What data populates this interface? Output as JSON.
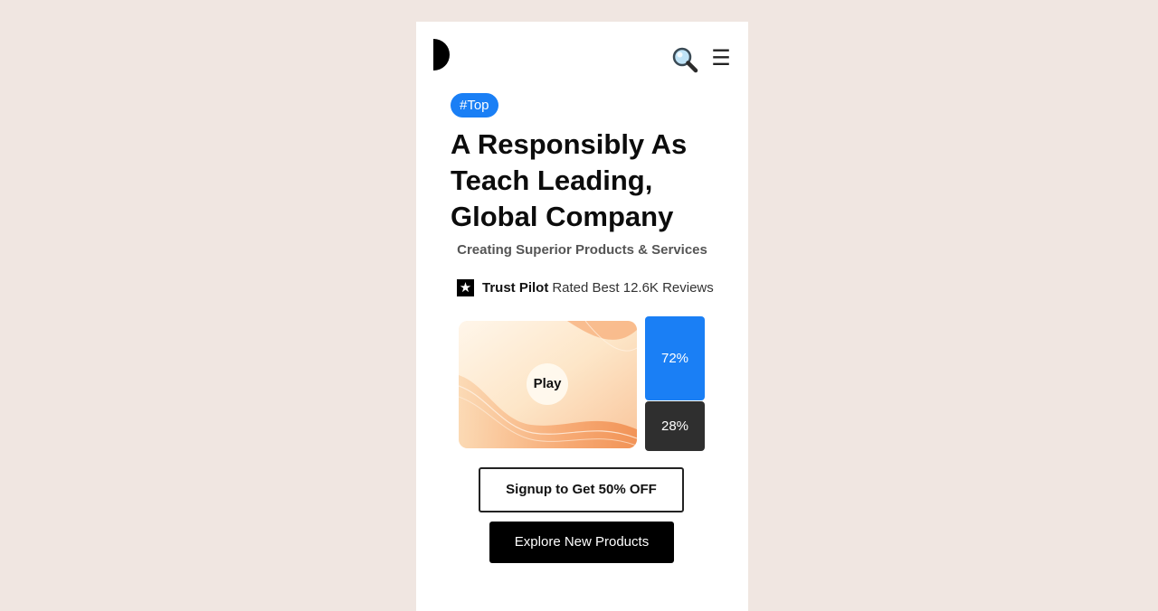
{
  "header": {
    "logo_icon": "half-circle-logo",
    "search_icon": "magnifier-icon",
    "menu_icon": "hamburger-menu-icon",
    "menu_glyph": "☰"
  },
  "hero": {
    "tag": "#Top",
    "headline": "A Responsibly As Teach Leading, Global Company",
    "subtitle": "Creating Superior Products & Services"
  },
  "trust": {
    "star_glyph": "★",
    "brand": "Trust Pilot",
    "text": "Rated Best 12.6K Reviews"
  },
  "media": {
    "play_label": "Play"
  },
  "stats": {
    "primary": "72%",
    "secondary": "28%"
  },
  "cta": {
    "signup_prefix": "Signup to",
    "signup_suffix": "Get 50% OFF",
    "explore": "Explore New Products"
  },
  "colors": {
    "page_bg": "#f0e6e1",
    "accent_blue": "#1a7ff5",
    "dark": "#2f2f2f"
  }
}
